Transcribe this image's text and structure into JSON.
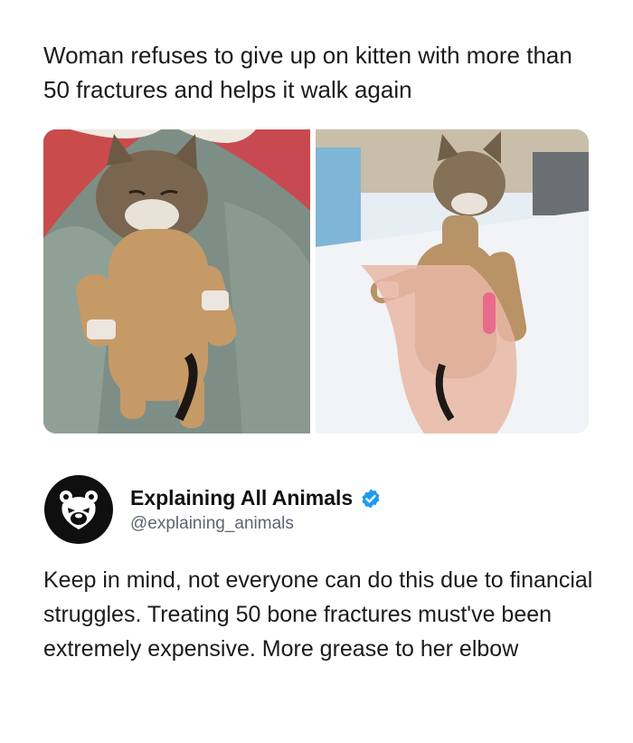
{
  "post": {
    "headline": "Woman refuses to give up on kitten with more than 50 fractures and helps it walk again"
  },
  "tweet": {
    "account_name": "Explaining All Animals",
    "handle": "@explaining_animals",
    "verified_icon": "verified-badge-icon",
    "avatar_icon": "bear-face-icon",
    "text": "Keep in mind, not everyone can do this due to financial struggles. Treating 50 bone fractures must've been extremely expensive. More grease to her elbow"
  },
  "colors": {
    "verified_blue": "#1d9bf0",
    "avatar_bg": "#0f0f0f",
    "handle_gray": "#5b6570"
  }
}
